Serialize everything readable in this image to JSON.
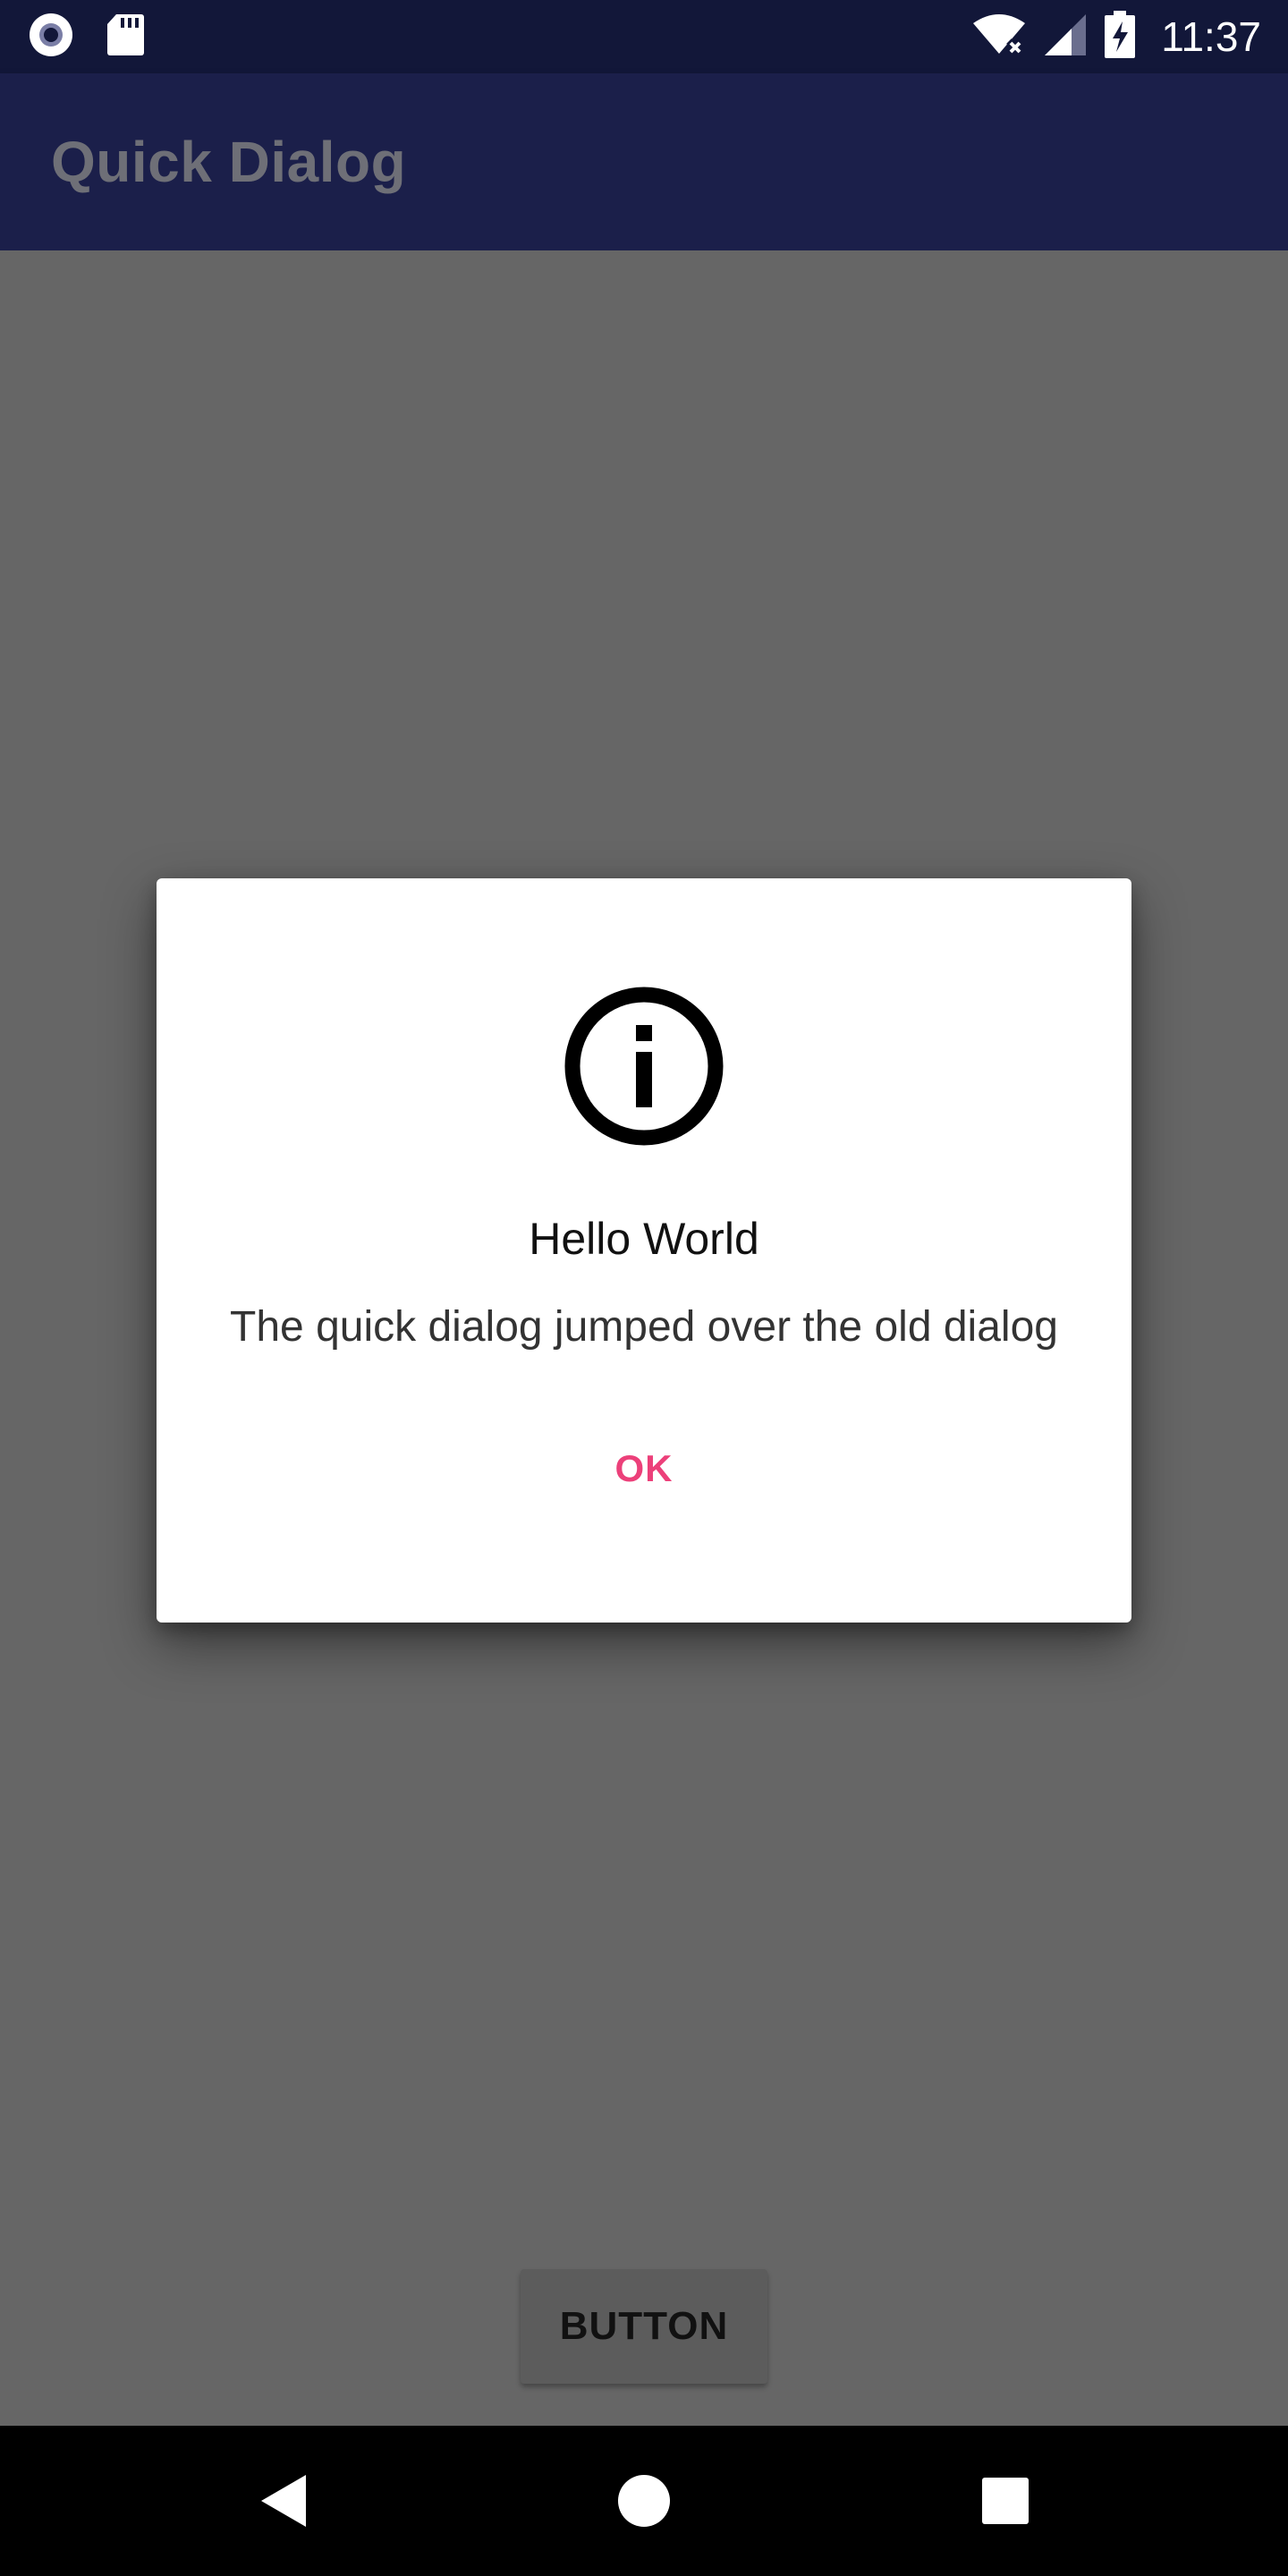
{
  "status_bar": {
    "time": "11:37",
    "left_icons": [
      "record-icon",
      "sd-card-icon"
    ],
    "right_icons": [
      "wifi-off-icon",
      "signal-icon",
      "battery-charging-icon"
    ]
  },
  "app_bar": {
    "title": "Quick Dialog"
  },
  "content": {
    "button_label": "BUTTON"
  },
  "dialog": {
    "icon": "info-icon",
    "title": "Hello World",
    "message": "The quick dialog jumped over the old dialog",
    "ok_label": "OK"
  },
  "nav_bar": {
    "icons": [
      "back-icon",
      "home-icon",
      "recents-icon"
    ]
  },
  "colors": {
    "status_bar": "#121739",
    "app_bar": "#1b1f4a",
    "scrim": "#666666",
    "accent": "#ec407a"
  }
}
